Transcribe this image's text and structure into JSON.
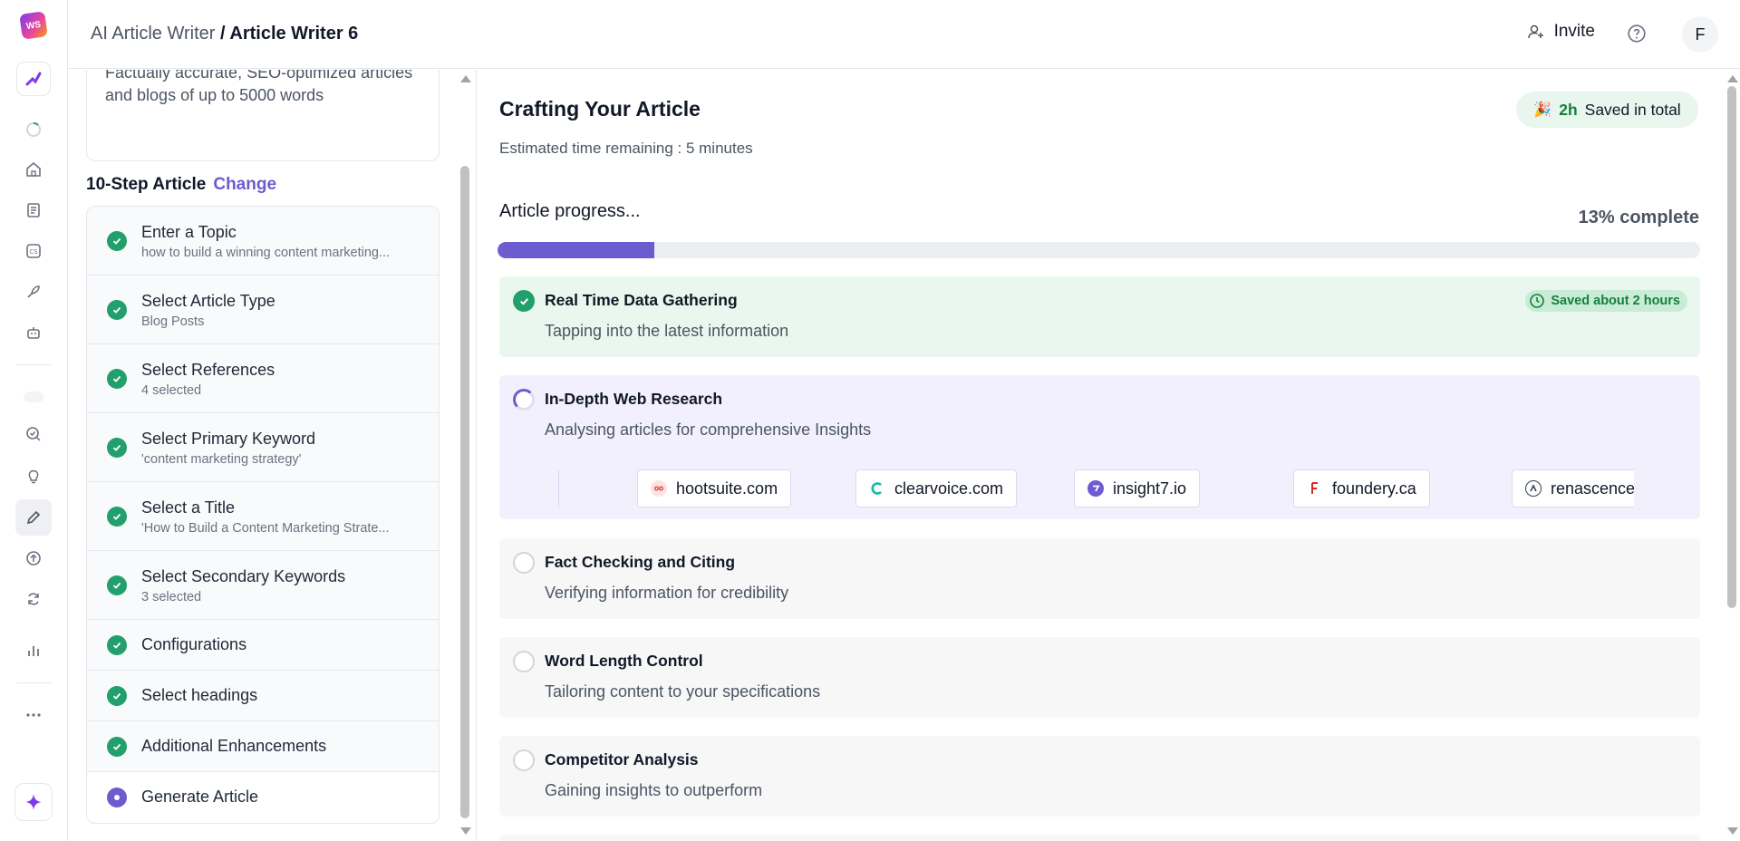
{
  "rail": {
    "logo_text": "WS"
  },
  "header": {
    "crumb_parent": "AI Article Writer",
    "crumb_sep": " / ",
    "crumb_current": "Article Writer 6",
    "invite_label": "Invite",
    "avatar_initial": "F"
  },
  "left": {
    "description": "Factually accurate, SEO-optimized articles and blogs of up to 5000 words",
    "steps_title": "10-Step Article",
    "change_label": "Change",
    "steps": [
      {
        "title": "Enter a Topic",
        "sub": "how to build a winning content marketing..."
      },
      {
        "title": "Select Article Type",
        "sub": "Blog Posts"
      },
      {
        "title": "Select References",
        "sub": "4 selected"
      },
      {
        "title": "Select Primary Keyword",
        "sub": "'content marketing strategy'"
      },
      {
        "title": "Select a Title",
        "sub": "'How to Build a Content Marketing Strate..."
      },
      {
        "title": "Select Secondary Keywords",
        "sub": "3 selected"
      },
      {
        "title": "Configurations",
        "sub": ""
      },
      {
        "title": "Select headings",
        "sub": ""
      },
      {
        "title": "Additional Enhancements",
        "sub": ""
      },
      {
        "title": "Generate Article",
        "sub": ""
      }
    ]
  },
  "main": {
    "title": "Crafting Your Article",
    "eta": "Estimated time remaining : 5 minutes",
    "saved_hours": "2h",
    "saved_label": "Saved in total",
    "progress_label": "Article progress...",
    "progress_text": "13% complete",
    "progress_value": 0.13,
    "tasks": [
      {
        "title": "Real Time Data Gathering",
        "sub": "Tapping into the latest information",
        "status": "done",
        "chip": "Saved about 2 hours"
      },
      {
        "title": "In-Depth Web Research",
        "sub": "Analysing articles for comprehensive Insights",
        "status": "active"
      },
      {
        "title": "Fact Checking and Citing",
        "sub": "Verifying information for credibility",
        "status": "pending"
      },
      {
        "title": "Word Length Control",
        "sub": "Tailoring content to your specifications",
        "status": "pending"
      },
      {
        "title": "Competitor Analysis",
        "sub": "Gaining insights to outperform",
        "status": "pending"
      }
    ],
    "sources": [
      {
        "name": "hootsuite.com",
        "color": "#e5484d"
      },
      {
        "name": "clearvoice.com",
        "color": "#14b8a6"
      },
      {
        "name": "insight7.io",
        "color": "#6d5bd0"
      },
      {
        "name": "foundery.ca",
        "color": "#dc2626"
      },
      {
        "name": "renascence",
        "color": "#374151"
      }
    ]
  },
  "colors": {
    "accent": "#6d5bd0",
    "success": "#22a06b"
  }
}
